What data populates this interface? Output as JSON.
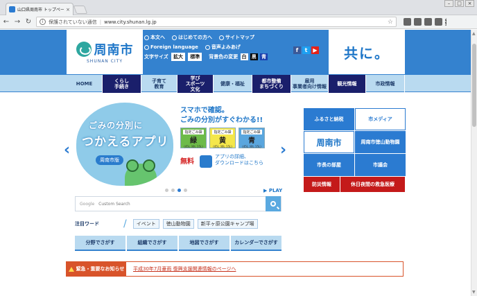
{
  "browser": {
    "tab_title": "山口県周南市 トップページ",
    "tab_close": "×",
    "security": "保護されていない通信",
    "url": "www.city.shunan.lg.jp",
    "window_buttons": [
      "–",
      "□",
      "×"
    ]
  },
  "header": {
    "logo_name": "周南市",
    "logo_sub": "SHUNAN CITY",
    "menu_row1": [
      "本文へ",
      "はじめての方へ",
      "サイトマップ"
    ],
    "menu_row2": [
      "Foreign language",
      "音声よみあげ"
    ],
    "font_size_label": "文字サイズ",
    "font_size_buttons": [
      "拡大",
      "標準"
    ],
    "bg_color_label": "背景色の変更",
    "bg_buttons": [
      "白",
      "黒",
      "青"
    ],
    "tagline": "共に。"
  },
  "nav": {
    "items": [
      "HOME",
      "くらし\n手続き",
      "子育て\n教育",
      "学び\nスポーツ\n文化",
      "健康・福祉",
      "都市整備\nまちづくり",
      "雇用\n事業者向け情報",
      "観光情報",
      "市政情報"
    ]
  },
  "carousel": {
    "banner_line1": "ごみの分別に",
    "banner_line2": "つかえるアプリ",
    "banner_ribbon": "周南市版",
    "promo_line1": "スマホで確認。",
    "promo_line2": "ごみの分別がすぐわかる!!",
    "cards": [
      {
        "label": "指定ごみ袋",
        "big": "緑",
        "num": "(45L.30L.15L)",
        "color": "#6dbb49"
      },
      {
        "label": "指定ごみ袋",
        "big": "黄",
        "num": "(45L.30L.15L)",
        "color": "#f4e74a"
      },
      {
        "label": "指定ごみ袋",
        "big": "青",
        "num": "(45L.30L.15L)",
        "color": "#5aa6de"
      }
    ],
    "free_label": "無料",
    "app_text": "アプリの詳細、\nダウンロードはこちら",
    "prev": "‹",
    "next": "›",
    "play_label": "▶ PLAY"
  },
  "search": {
    "google": "Google",
    "placeholder": "Custom Search"
  },
  "keywords": {
    "label": "注目ワード",
    "tags": [
      "イベント",
      "徳山動物園",
      "新平ヶ原公園キャンプ場"
    ]
  },
  "quick_nav": [
    "分野でさがす",
    "組織でさがす",
    "地図でさがす",
    "カレンダーでさがす"
  ],
  "alert": {
    "heading": "緊急・重要なお知らせ",
    "link": "平成30年7月豪雨 復興支援関連情報のページへ"
  },
  "side_links": {
    "grid": [
      "ふるさと納税",
      "市メディア",
      "周南市",
      "周南市徳山動物園",
      "市長の部屋",
      "市議会"
    ],
    "red": [
      "防災情報",
      "休日夜間の救急医療"
    ]
  },
  "colors": {
    "brand": "#3482cf",
    "nav_bg": "#b9daf0",
    "nav_dark": "#1a1f6b",
    "alert": "#d8532a",
    "emergency": "#c41a1a"
  }
}
